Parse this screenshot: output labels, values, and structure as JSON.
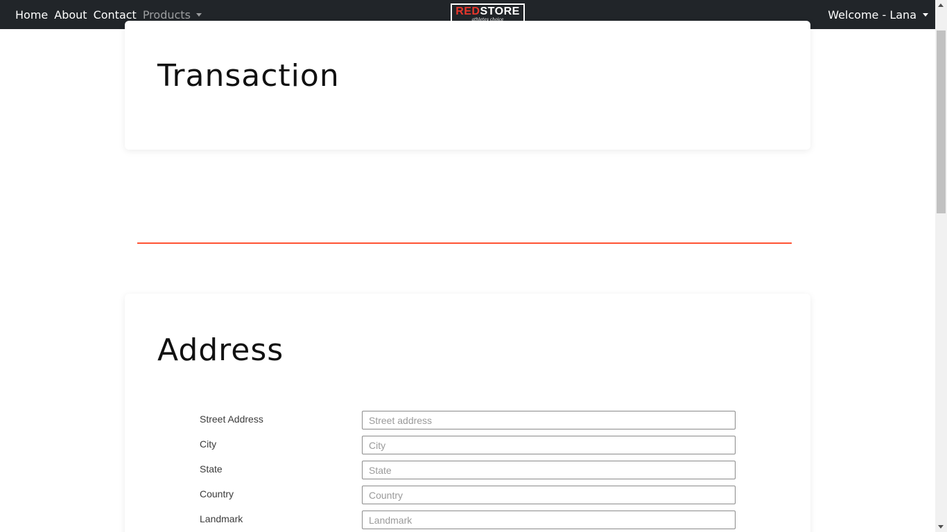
{
  "navbar": {
    "links": [
      {
        "label": "Home"
      },
      {
        "label": "About"
      },
      {
        "label": "Contact"
      }
    ],
    "products_label": "Products",
    "logo": {
      "main_red": "RED",
      "main_white": "STORE",
      "tagline": "athletes choice"
    },
    "welcome_label": "Welcome - Lana"
  },
  "transaction": {
    "title": "Transaction"
  },
  "address": {
    "title": "Address",
    "fields": [
      {
        "label": "Street Address",
        "placeholder": "Street address",
        "value": ""
      },
      {
        "label": "City",
        "placeholder": "City",
        "value": ""
      },
      {
        "label": "State",
        "placeholder": "State",
        "value": ""
      },
      {
        "label": "Country",
        "placeholder": "Country",
        "value": ""
      },
      {
        "label": "Landmark",
        "placeholder": "Landmark",
        "value": ""
      }
    ]
  },
  "colors": {
    "navbar_bg": "#212529",
    "accent_divider": "#ff5232",
    "logo_red": "#e8372c"
  }
}
